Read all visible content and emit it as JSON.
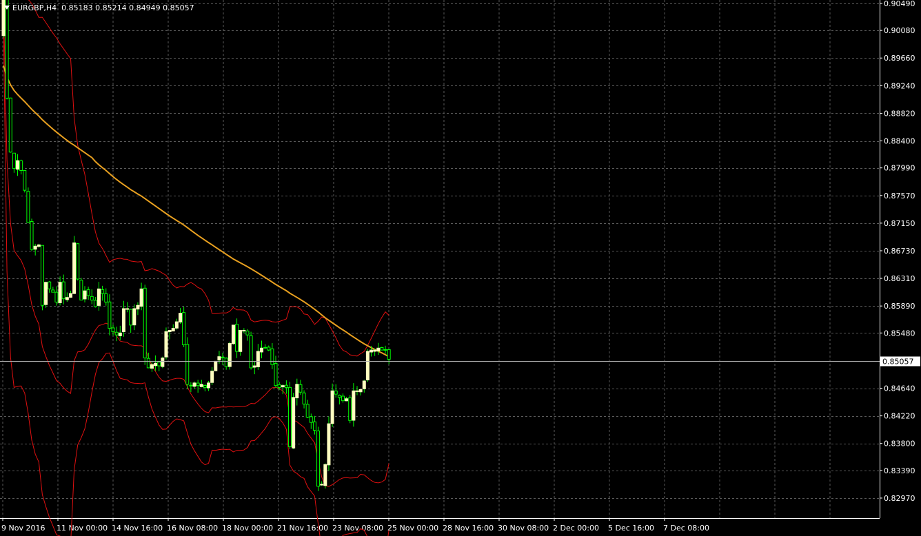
{
  "header": {
    "dropdown_icon": "triangle-down-icon",
    "symbol": "EURGBP,H4",
    "quote": "0.85183 0.85214 0.84949 0.85057"
  },
  "colors": {
    "background": "#000000",
    "grid": "#5a5a5a",
    "axis": "#ffffff",
    "text": "#ffffff",
    "bull_candle_fill": "#ffffc0",
    "bull_candle_wick": "#00ff00",
    "bear_candle_fill": "#000000",
    "bear_candle_wick": "#00ff00",
    "bollinger_band": "#e01010",
    "moving_average": "#e8a020",
    "current_price_line": "#b0b0b0",
    "price_tag_bg": "#ffffff",
    "price_tag_text": "#000000"
  },
  "chart_data": {
    "type": "candlestick",
    "symbol": "EURGBP",
    "timeframe": "H4",
    "ylim": [
      0.8276,
      0.9049
    ],
    "y_ticks": [
      "0.90490",
      "0.90080",
      "0.89660",
      "0.89240",
      "0.88820",
      "0.88400",
      "0.87990",
      "0.87570",
      "0.87150",
      "0.86730",
      "0.86310",
      "0.85890",
      "0.85480",
      "0.85057",
      "0.84640",
      "0.84220",
      "0.83800",
      "0.83390",
      "0.82970"
    ],
    "current_price": "0.85057",
    "x_labels": [
      "9 Nov 2016",
      "11 Nov 00:00",
      "14 Nov 16:00",
      "16 Nov 08:00",
      "18 Nov 00:00",
      "21 Nov 16:00",
      "23 Nov 08:00",
      "25 Nov 00:00",
      "28 Nov 16:00",
      "30 Nov 08:00",
      "2 Dec 00:00",
      "5 Dec 16:00",
      "7 Dec 08:00"
    ],
    "closes": [
      0.9093,
      0.8905,
      0.8823,
      0.8798,
      0.881,
      0.8795,
      0.8765,
      0.8716,
      0.8675,
      0.868,
      0.8682,
      0.859,
      0.8625,
      0.8615,
      0.861,
      0.8595,
      0.8625,
      0.86,
      0.8602,
      0.8608,
      0.8685,
      0.863,
      0.8598,
      0.8612,
      0.8605,
      0.8598,
      0.8588,
      0.8615,
      0.8608,
      0.8595,
      0.8555,
      0.855,
      0.8545,
      0.8548,
      0.8585,
      0.8585,
      0.856,
      0.8585,
      0.859,
      0.8615,
      0.851,
      0.8495,
      0.85,
      0.8502,
      0.8498,
      0.851,
      0.855,
      0.8552,
      0.8555,
      0.8565,
      0.8578,
      0.853,
      0.847,
      0.8468,
      0.8472,
      0.8468,
      0.847,
      0.8465,
      0.8472,
      0.849,
      0.8505,
      0.8512,
      0.851,
      0.8497,
      0.8532,
      0.856,
      0.852,
      0.8552,
      0.8552,
      0.8545,
      0.8495,
      0.8498,
      0.852,
      0.8525,
      0.8525,
      0.8522,
      0.85,
      0.8468,
      0.8465,
      0.8468,
      0.8465,
      0.8375,
      0.845,
      0.847,
      0.8458,
      0.844,
      0.842,
      0.8412,
      0.84,
      0.8315,
      0.8318,
      0.8348,
      0.841,
      0.846,
      0.8455,
      0.845,
      0.8445,
      0.8448,
      0.8415,
      0.846,
      0.846,
      0.8462,
      0.8475,
      0.852,
      0.8522,
      0.8522,
      0.8525,
      0.8522,
      0.8522,
      0.8508
    ],
    "moving_average_last": 0.8523,
    "bollinger_upper_last": 0.856,
    "bollinger_lower_last": 0.846,
    "outer_band_lower_last": 0.838
  }
}
